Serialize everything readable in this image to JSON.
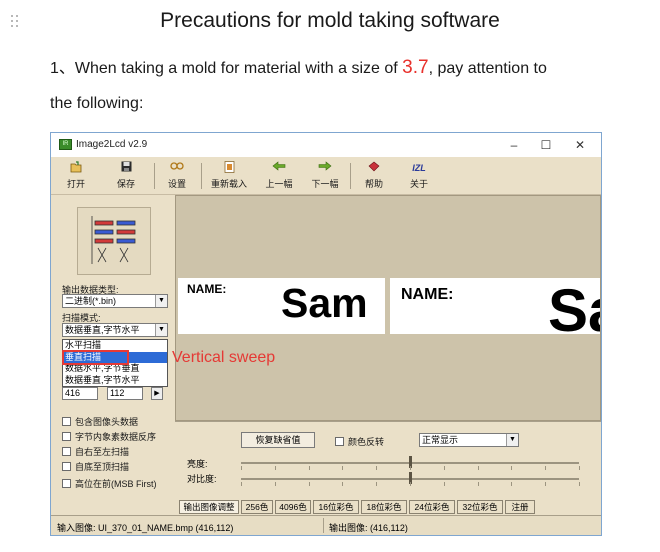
{
  "document": {
    "title": "Precautions for mold taking software",
    "line1_prefix": "1、When taking a mold for material with a size of ",
    "line1_highlight": "3.7",
    "line1_suffix": ", pay attention to",
    "line2": "the following:"
  },
  "window": {
    "title": "Image2Lcd v2.9",
    "icon_text": "IR",
    "minimize": "–",
    "maximize": "☐",
    "close": "✕"
  },
  "toolbar": {
    "open": "打开",
    "save": "保存",
    "settings": "设置",
    "reload": "重新载入",
    "prev": "上一幅",
    "next": "下一幅",
    "help": "帮助",
    "about": "关于",
    "about_icon_text": "IZL"
  },
  "left_panel": {
    "output_type_label": "输出数据类型:",
    "output_type_value": "二进制(*.bin)",
    "scan_mode_label": "扫描模式:",
    "scan_mode_value": "数据垂直,字节水平",
    "scan_options": [
      "水平扫描",
      "垂直扫描",
      "数据水平,字节垂直",
      "数据垂直,字节水平"
    ],
    "selected_option_index": 1,
    "width_value": "416",
    "height_value": "112",
    "checkboxes": [
      "包含图像头数据",
      "字节内象素数据反序",
      "自右至左扫描",
      "自底至顶扫描",
      "高位在前(MSB First)"
    ]
  },
  "annotation": "Vertical sweep",
  "preview": {
    "input_name_label": "NAME:",
    "input_big_text": "Sam",
    "output_name_label": "NAME:",
    "output_big_text": "Sa"
  },
  "controls": {
    "restore_button": "恢复缺省值",
    "invert_colors": "颜色反转",
    "display_mode": "正常显示",
    "brightness_label": "亮度:",
    "contrast_label": "对比度:",
    "brightness_level": 0.5,
    "contrast_level": 0.5
  },
  "tabs": [
    "输出图像调整",
    "256色",
    "4096色",
    "16位彩色",
    "18位彩色",
    "24位彩色",
    "32位彩色",
    "注册"
  ],
  "status": {
    "input_image": "输入图像: UI_370_01_NAME.bmp (416,112)",
    "output_image": "输出图像: (416,112)"
  }
}
